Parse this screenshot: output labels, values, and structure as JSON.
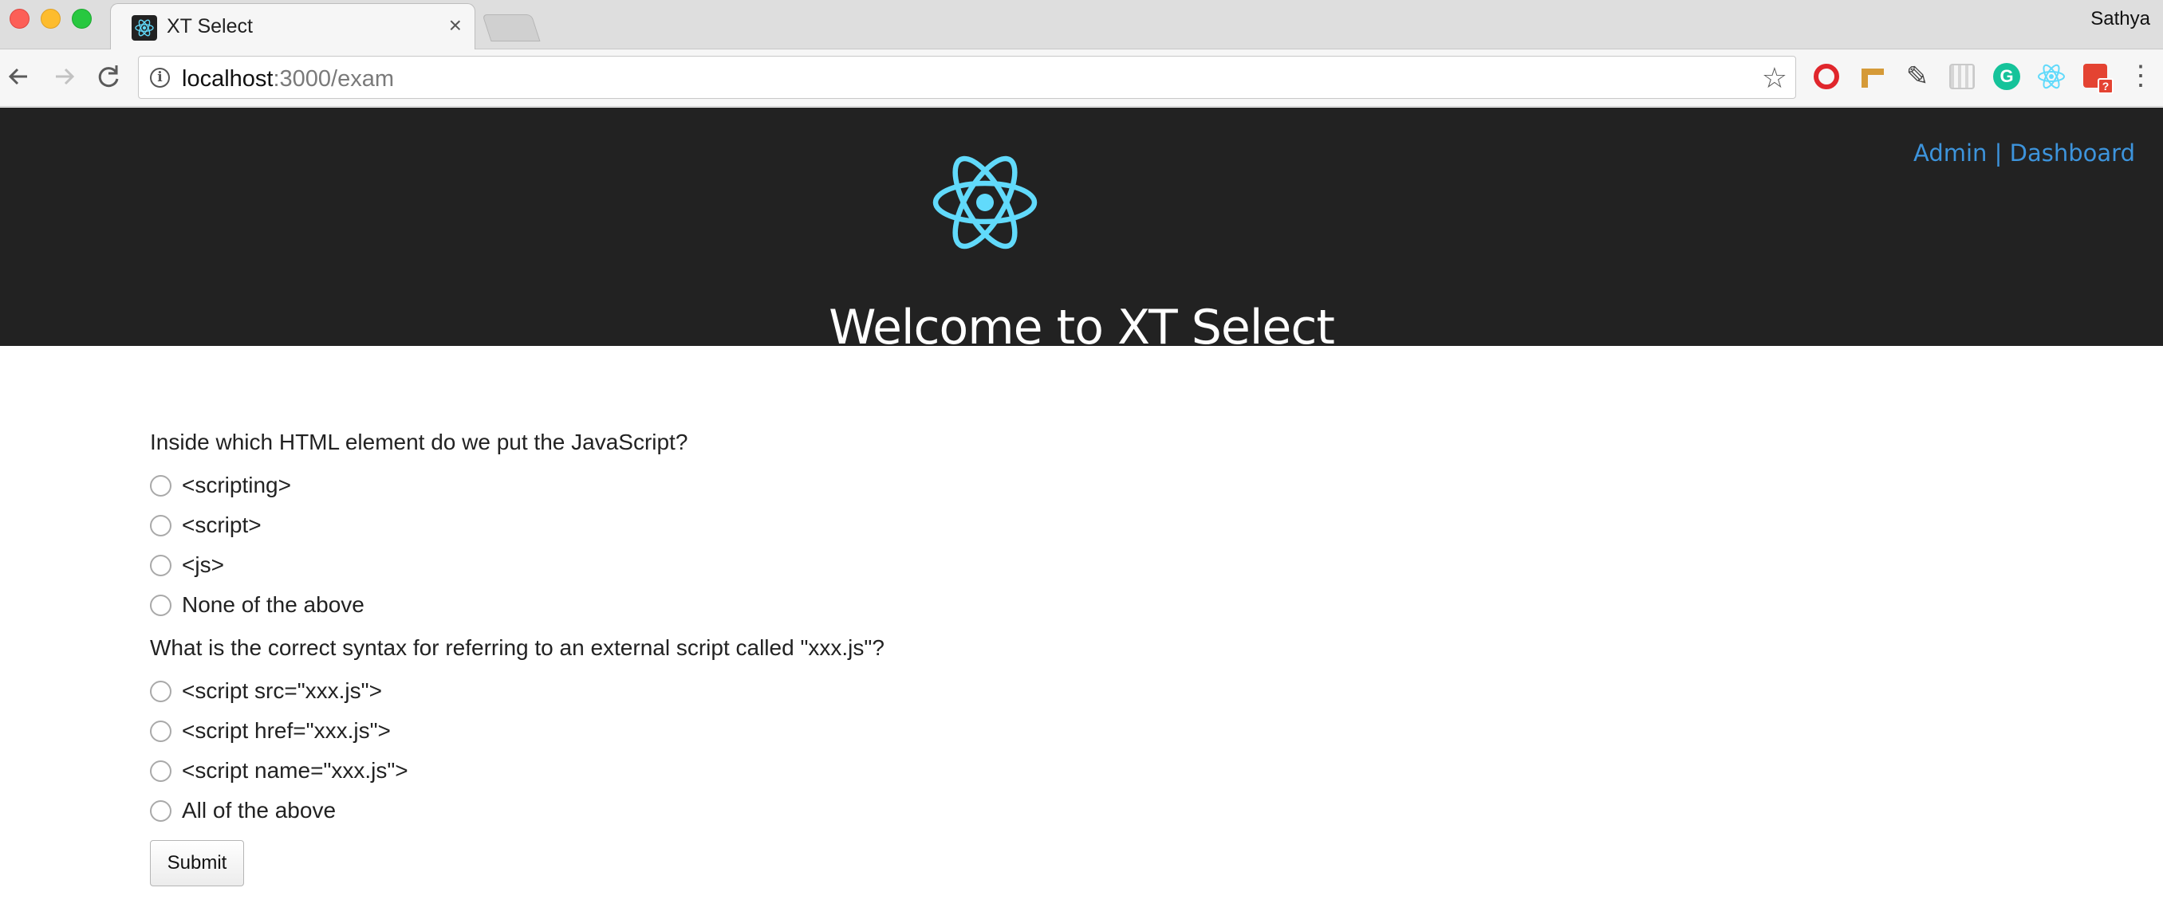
{
  "browser": {
    "tab_title": "XT Select",
    "tab_close": "×",
    "profile_name": "Sathya",
    "url_host": "localhost",
    "url_path": ":3000/exam"
  },
  "header": {
    "admin_link": "Admin",
    "separator": "|",
    "dashboard_link": "Dashboard",
    "welcome": "Welcome to XT Select",
    "logo_color": "#61dafb"
  },
  "questions": [
    {
      "text": "Inside which HTML element do we put the JavaScript?",
      "options": [
        "<scripting>",
        "<script>",
        "<js>",
        "None of the above"
      ]
    },
    {
      "text": "What is the correct syntax for referring to an external script called \"xxx.js\"?",
      "options": [
        "<script src=\"xxx.js\">",
        "<script href=\"xxx.js\">",
        "<script name=\"xxx.js\">",
        "All of the above"
      ]
    }
  ],
  "submit_label": "Submit",
  "icons": {
    "back": "back-arrow-icon",
    "forward": "forward-arrow-icon",
    "reload": "reload-icon",
    "info": "info-icon",
    "bookmark": "star-icon"
  }
}
